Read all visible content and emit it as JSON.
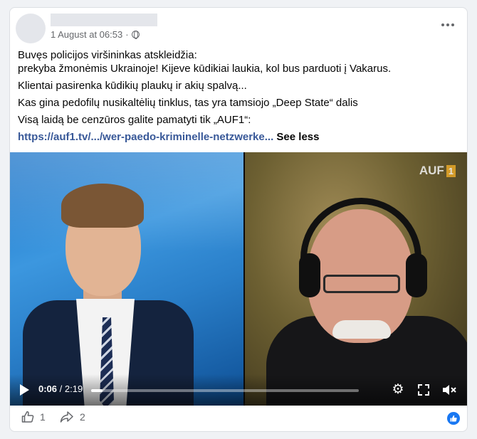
{
  "post": {
    "timestamp": "1 August at 06:53",
    "privacy_icon": "globe-icon",
    "more_icon": "more-options-icon"
  },
  "text": {
    "line1": "Buvęs policijos viršininkas atskleidžia:",
    "line2": "prekyba žmonėmis Ukrainoje! Kijeve kūdikiai laukia, kol bus parduoti į Vakarus.",
    "line3": "Klientai pasirenka kūdikių plaukų ir akių spalvą...",
    "line4": "Kas gina pedofilų nusikaltėlių tinklus, tas yra tamsiojo „Deep State“ dalis",
    "line5": "Visą laidą be cenzūros galite pamatyti tik „AUF1“:",
    "link": "https://auf1.tv/.../wer-paedo-kriminelle-netzwerke...",
    "see_less": "See less"
  },
  "video": {
    "logo_text": "AUF",
    "logo_badge": "1",
    "current_time": "0:06",
    "separator": "/",
    "duration": "2:19",
    "progress_fraction": 0.043,
    "icons": [
      "play-icon",
      "settings-icon",
      "fullscreen-icon",
      "mute-icon"
    ]
  },
  "footer": {
    "likes": "1",
    "shares": "2"
  },
  "colors": {
    "link": "#385898",
    "meta": "#65676b",
    "brand_blue": "#1877f2",
    "auf_accent": "#e8a828"
  }
}
